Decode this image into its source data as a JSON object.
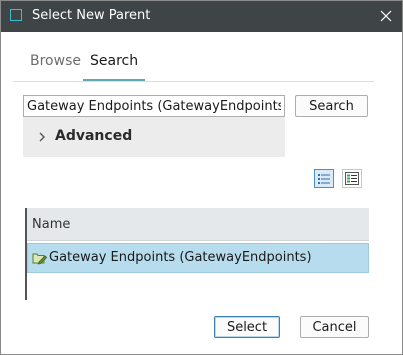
{
  "window": {
    "title": "Select New Parent"
  },
  "tabs": [
    {
      "label": "Browse",
      "active": false
    },
    {
      "label": "Search",
      "active": true
    }
  ],
  "search": {
    "value": "Gateway Endpoints (GatewayEndpoints)",
    "button_label": "Search"
  },
  "advanced": {
    "label": "Advanced",
    "expanded": false
  },
  "view_toggle": {
    "selected": "list-view"
  },
  "table": {
    "columns": [
      "Name"
    ],
    "rows": [
      {
        "name": "Gateway Endpoints (GatewayEndpoints)",
        "icon": "folder-edit-icon",
        "selected": true
      }
    ]
  },
  "footer": {
    "select_label": "Select",
    "cancel_label": "Cancel"
  },
  "colors": {
    "titlebar": "#3f4447",
    "accent": "#63a6b5",
    "selection": "#b7dced"
  }
}
